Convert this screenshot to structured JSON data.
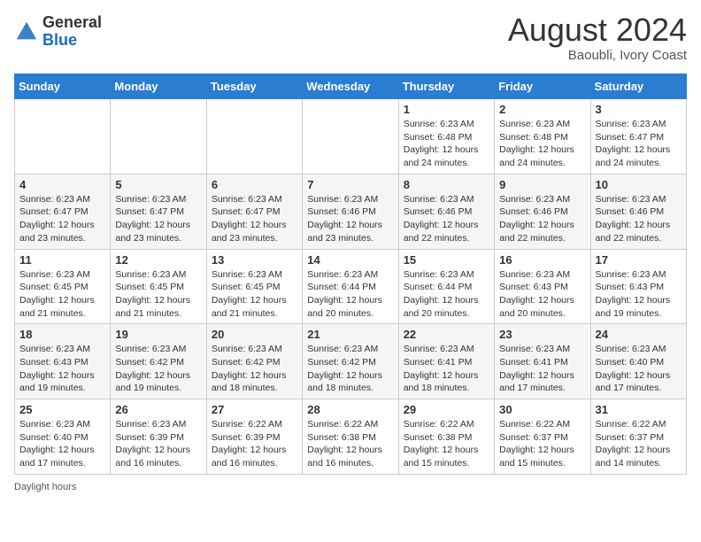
{
  "header": {
    "logo_general": "General",
    "logo_blue": "Blue",
    "month_year": "August 2024",
    "location": "Baoubli, Ivory Coast"
  },
  "weekdays": [
    "Sunday",
    "Monday",
    "Tuesday",
    "Wednesday",
    "Thursday",
    "Friday",
    "Saturday"
  ],
  "weeks": [
    [
      {
        "day": "",
        "info": ""
      },
      {
        "day": "",
        "info": ""
      },
      {
        "day": "",
        "info": ""
      },
      {
        "day": "",
        "info": ""
      },
      {
        "day": "1",
        "info": "Sunrise: 6:23 AM\nSunset: 6:48 PM\nDaylight: 12 hours and 24 minutes."
      },
      {
        "day": "2",
        "info": "Sunrise: 6:23 AM\nSunset: 6:48 PM\nDaylight: 12 hours and 24 minutes."
      },
      {
        "day": "3",
        "info": "Sunrise: 6:23 AM\nSunset: 6:47 PM\nDaylight: 12 hours and 24 minutes."
      }
    ],
    [
      {
        "day": "4",
        "info": "Sunrise: 6:23 AM\nSunset: 6:47 PM\nDaylight: 12 hours and 23 minutes."
      },
      {
        "day": "5",
        "info": "Sunrise: 6:23 AM\nSunset: 6:47 PM\nDaylight: 12 hours and 23 minutes."
      },
      {
        "day": "6",
        "info": "Sunrise: 6:23 AM\nSunset: 6:47 PM\nDaylight: 12 hours and 23 minutes."
      },
      {
        "day": "7",
        "info": "Sunrise: 6:23 AM\nSunset: 6:46 PM\nDaylight: 12 hours and 23 minutes."
      },
      {
        "day": "8",
        "info": "Sunrise: 6:23 AM\nSunset: 6:46 PM\nDaylight: 12 hours and 22 minutes."
      },
      {
        "day": "9",
        "info": "Sunrise: 6:23 AM\nSunset: 6:46 PM\nDaylight: 12 hours and 22 minutes."
      },
      {
        "day": "10",
        "info": "Sunrise: 6:23 AM\nSunset: 6:46 PM\nDaylight: 12 hours and 22 minutes."
      }
    ],
    [
      {
        "day": "11",
        "info": "Sunrise: 6:23 AM\nSunset: 6:45 PM\nDaylight: 12 hours and 21 minutes."
      },
      {
        "day": "12",
        "info": "Sunrise: 6:23 AM\nSunset: 6:45 PM\nDaylight: 12 hours and 21 minutes."
      },
      {
        "day": "13",
        "info": "Sunrise: 6:23 AM\nSunset: 6:45 PM\nDaylight: 12 hours and 21 minutes."
      },
      {
        "day": "14",
        "info": "Sunrise: 6:23 AM\nSunset: 6:44 PM\nDaylight: 12 hours and 20 minutes."
      },
      {
        "day": "15",
        "info": "Sunrise: 6:23 AM\nSunset: 6:44 PM\nDaylight: 12 hours and 20 minutes."
      },
      {
        "day": "16",
        "info": "Sunrise: 6:23 AM\nSunset: 6:43 PM\nDaylight: 12 hours and 20 minutes."
      },
      {
        "day": "17",
        "info": "Sunrise: 6:23 AM\nSunset: 6:43 PM\nDaylight: 12 hours and 19 minutes."
      }
    ],
    [
      {
        "day": "18",
        "info": "Sunrise: 6:23 AM\nSunset: 6:43 PM\nDaylight: 12 hours and 19 minutes."
      },
      {
        "day": "19",
        "info": "Sunrise: 6:23 AM\nSunset: 6:42 PM\nDaylight: 12 hours and 19 minutes."
      },
      {
        "day": "20",
        "info": "Sunrise: 6:23 AM\nSunset: 6:42 PM\nDaylight: 12 hours and 18 minutes."
      },
      {
        "day": "21",
        "info": "Sunrise: 6:23 AM\nSunset: 6:42 PM\nDaylight: 12 hours and 18 minutes."
      },
      {
        "day": "22",
        "info": "Sunrise: 6:23 AM\nSunset: 6:41 PM\nDaylight: 12 hours and 18 minutes."
      },
      {
        "day": "23",
        "info": "Sunrise: 6:23 AM\nSunset: 6:41 PM\nDaylight: 12 hours and 17 minutes."
      },
      {
        "day": "24",
        "info": "Sunrise: 6:23 AM\nSunset: 6:40 PM\nDaylight: 12 hours and 17 minutes."
      }
    ],
    [
      {
        "day": "25",
        "info": "Sunrise: 6:23 AM\nSunset: 6:40 PM\nDaylight: 12 hours and 17 minutes."
      },
      {
        "day": "26",
        "info": "Sunrise: 6:23 AM\nSunset: 6:39 PM\nDaylight: 12 hours and 16 minutes."
      },
      {
        "day": "27",
        "info": "Sunrise: 6:22 AM\nSunset: 6:39 PM\nDaylight: 12 hours and 16 minutes."
      },
      {
        "day": "28",
        "info": "Sunrise: 6:22 AM\nSunset: 6:38 PM\nDaylight: 12 hours and 16 minutes."
      },
      {
        "day": "29",
        "info": "Sunrise: 6:22 AM\nSunset: 6:38 PM\nDaylight: 12 hours and 15 minutes."
      },
      {
        "day": "30",
        "info": "Sunrise: 6:22 AM\nSunset: 6:37 PM\nDaylight: 12 hours and 15 minutes."
      },
      {
        "day": "31",
        "info": "Sunrise: 6:22 AM\nSunset: 6:37 PM\nDaylight: 12 hours and 14 minutes."
      }
    ]
  ],
  "footer": {
    "daylight_hours_label": "Daylight hours"
  }
}
